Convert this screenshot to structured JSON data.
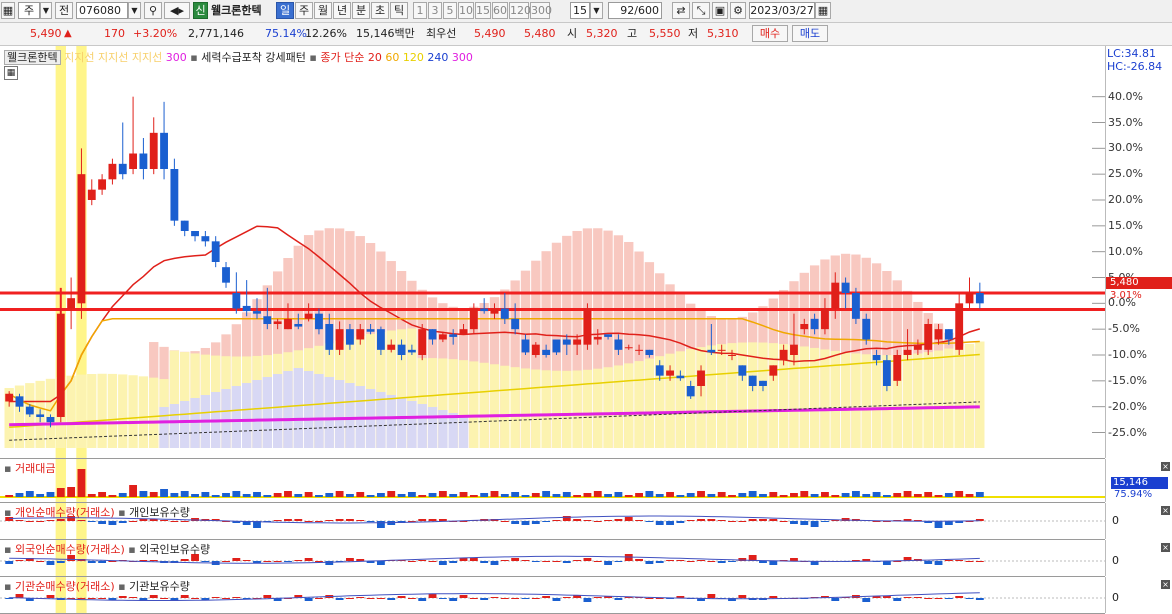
{
  "toolbar": {
    "market": "주",
    "prev": "전",
    "code": "076080",
    "stock_name": "웰크론한텍",
    "shin": "신",
    "periods": [
      "일",
      "주",
      "월",
      "년",
      "분",
      "초",
      "틱"
    ],
    "intervals": [
      "1",
      "3",
      "5",
      "10",
      "15",
      "60",
      "120",
      "300"
    ],
    "interval_count": "15",
    "bar_count": "92/600",
    "date": "2023/03/27"
  },
  "quote": {
    "price": "5,490",
    "arrow": "▲",
    "change": "170",
    "change_pct": "+3.20%",
    "volume": "2,771,146",
    "vol_ratio": "75.14%",
    "turnover": "12.26%",
    "amount": "15,146백만",
    "best_label": "최우선",
    "ask": "5,490",
    "bid": "5,480",
    "open_label": "시",
    "open": "5,320",
    "high_label": "고",
    "high": "5,550",
    "low_label": "저",
    "low": "5,310",
    "buy": "매수",
    "sell": "매도"
  },
  "main_legend": {
    "name": "웰크론한텍",
    "support1": "지지선",
    "support2": "지지선",
    "support3": "지지선",
    "n300": "300",
    "pattern": "세력수급포착 강세패턴",
    "ma_label": "종가 단순",
    "ma": [
      {
        "label": "20",
        "color": "#e0201a"
      },
      {
        "label": "60",
        "color": "#f0a800"
      },
      {
        "label": "120",
        "color": "#e8d000"
      },
      {
        "label": "240",
        "color": "#1a3fd0"
      },
      {
        "label": "300",
        "color": "#e020e0"
      }
    ],
    "lc": "LC:34.81",
    "hc": "HC:-26.84",
    "price_tag": "5,480",
    "pct_tag": "3.01%"
  },
  "y_axis": [
    "40.0%",
    "35.0%",
    "30.0%",
    "25.0%",
    "20.0%",
    "15.0%",
    "10.0%",
    "5.0%",
    "0.0%",
    "-5.0%",
    "-10.0%",
    "-15.0%",
    "-20.0%",
    "-25.0%"
  ],
  "volume_panel": {
    "title": "거래대금",
    "tag": "15,146",
    "tag2": "75.94%"
  },
  "panels": [
    {
      "title": "개인순매수량(거래소)",
      "sub": "개인보유수량",
      "zero": "0"
    },
    {
      "title": "외국인순매수량(거래소)",
      "sub": "외국인보유수량",
      "zero": "0"
    },
    {
      "title": "기관순매수량(거래소)",
      "sub": "기관보유수량",
      "zero": "0"
    }
  ],
  "colors": {
    "up": "#e0201a",
    "down": "#1a5fd0",
    "ma20": "#e0201a",
    "ma60": "#f0a800",
    "ma120": "#e8d000",
    "ma300": "#e020e0",
    "highlight": "#fff58a"
  },
  "chart_data": {
    "type": "candlestick",
    "candles": [
      [
        -19,
        -17.5,
        -20,
        -17
      ],
      [
        -18,
        -20,
        -21,
        -17.5
      ],
      [
        -20,
        -21.5,
        -22,
        -19.5
      ],
      [
        -21.5,
        -22,
        -23,
        -20.5
      ],
      [
        -22,
        -23,
        -24,
        -21.5
      ],
      [
        -22,
        -2,
        -23,
        -1
      ],
      [
        -1,
        1,
        -5,
        5
      ],
      [
        0,
        25,
        -3,
        30
      ],
      [
        20,
        22,
        19,
        24
      ],
      [
        22,
        24,
        21,
        25
      ],
      [
        24,
        27,
        23,
        28
      ],
      [
        27,
        25,
        24,
        35
      ],
      [
        26,
        29,
        25,
        40
      ],
      [
        29,
        26,
        24,
        32
      ],
      [
        26,
        33,
        25,
        36
      ],
      [
        33,
        26,
        24,
        39
      ],
      [
        26,
        16,
        15,
        28
      ],
      [
        16,
        14,
        13,
        16
      ],
      [
        14,
        13,
        12,
        14
      ],
      [
        13,
        12,
        11,
        14
      ],
      [
        12,
        8,
        7,
        13
      ],
      [
        7,
        4,
        3,
        8
      ],
      [
        2,
        -1,
        -2,
        6
      ],
      [
        -0.5,
        -1.5,
        -2.5,
        4.5
      ],
      [
        -1.5,
        -2,
        -3,
        1
      ],
      [
        -2.5,
        -4,
        -5,
        3
      ],
      [
        -4,
        -3.5,
        -5,
        -3
      ],
      [
        -5,
        -3,
        -5,
        0
      ],
      [
        -4,
        -4.5,
        -5,
        -2
      ],
      [
        -3,
        -2,
        -3.5,
        0
      ],
      [
        -2,
        -5,
        -6,
        -1
      ],
      [
        -4,
        -9,
        -10,
        -2
      ],
      [
        -9,
        -5,
        -10,
        -3.5
      ],
      [
        -5,
        -8,
        -9,
        -4
      ],
      [
        -7,
        -5,
        -8,
        -4
      ],
      [
        -5,
        -5.5,
        -6,
        -4
      ],
      [
        -5,
        -9,
        -10,
        -4.5
      ],
      [
        -9,
        -8,
        -9.5,
        -7
      ],
      [
        -8,
        -10,
        -11,
        -7
      ],
      [
        -9,
        -9.5,
        -10,
        -8
      ],
      [
        -10,
        -5,
        -11,
        -4
      ],
      [
        -5,
        -7,
        -8,
        -5
      ],
      [
        -7,
        -6,
        -7.5,
        -5.5
      ],
      [
        -6,
        -6.5,
        -8,
        -5
      ],
      [
        -6,
        -5,
        -6,
        -4
      ],
      [
        -5,
        -1,
        -6,
        0
      ],
      [
        -1,
        -1.5,
        -2,
        1
      ],
      [
        -2,
        -1,
        -3,
        0
      ],
      [
        -1,
        -3,
        -4,
        2
      ],
      [
        -3,
        -5,
        -6,
        0
      ],
      [
        -7,
        -9.5,
        -10,
        -6
      ],
      [
        -10,
        -8,
        -10.5,
        -7.5
      ],
      [
        -9,
        -10,
        -10.5,
        -8
      ],
      [
        -7,
        -9.5,
        -10,
        -7
      ],
      [
        -7,
        -8,
        -10,
        -6
      ],
      [
        -8,
        -7,
        -10,
        -6
      ],
      [
        -8,
        -1,
        -9,
        0
      ],
      [
        -7,
        -6.5,
        -8,
        -5
      ],
      [
        -6,
        -6.5,
        -7,
        -6
      ],
      [
        -7,
        -9,
        -10,
        -6
      ],
      [
        -8.5,
        -8.5,
        -9,
        -8
      ],
      [
        -9,
        -9,
        -10,
        -8
      ],
      [
        -9,
        -10,
        -10.5,
        -9
      ],
      [
        -12,
        -14,
        -15,
        -11
      ],
      [
        -14,
        -13,
        -15,
        -12
      ],
      [
        -14,
        -14.5,
        -15,
        -13
      ],
      [
        -16,
        -18,
        -18.5,
        -15
      ],
      [
        -16,
        -13,
        -18,
        -12
      ],
      [
        -9,
        -9.5,
        -10,
        -4
      ],
      [
        -9,
        -9,
        -10,
        -8
      ],
      [
        -10,
        -10,
        -11,
        -9
      ],
      [
        -12,
        -14,
        -15,
        -12
      ],
      [
        -14,
        -16,
        -17,
        -14
      ],
      [
        -15,
        -16,
        -17,
        -15
      ],
      [
        -14,
        -12,
        -15,
        -12
      ],
      [
        -11,
        -9,
        -12,
        -8
      ],
      [
        -10,
        -8,
        -12,
        -2
      ],
      [
        -5,
        -4,
        -6,
        -3
      ],
      [
        -3,
        -5,
        -6,
        -2
      ],
      [
        -5,
        -1,
        -6,
        1
      ],
      [
        -1,
        4,
        -3,
        6
      ],
      [
        4,
        2,
        -1,
        5
      ],
      [
        2,
        -3,
        -4,
        3
      ],
      [
        -3,
        -7,
        -8,
        -2
      ],
      [
        -10,
        -11,
        -12,
        -9
      ],
      [
        -11,
        -16,
        -17,
        -10
      ],
      [
        -15,
        -10,
        -16,
        -9
      ],
      [
        -10,
        -9,
        -11,
        -5
      ],
      [
        -9,
        -8,
        -10,
        -7
      ],
      [
        -9,
        -4,
        -10,
        -3
      ],
      [
        -7,
        -5,
        -8,
        -4
      ],
      [
        -5,
        -7,
        -8,
        -5
      ],
      [
        -9,
        0,
        -10,
        2
      ],
      [
        0,
        2,
        -1,
        5
      ],
      [
        2,
        0,
        -1,
        4
      ]
    ],
    "ylim": [
      -28,
      44
    ]
  }
}
